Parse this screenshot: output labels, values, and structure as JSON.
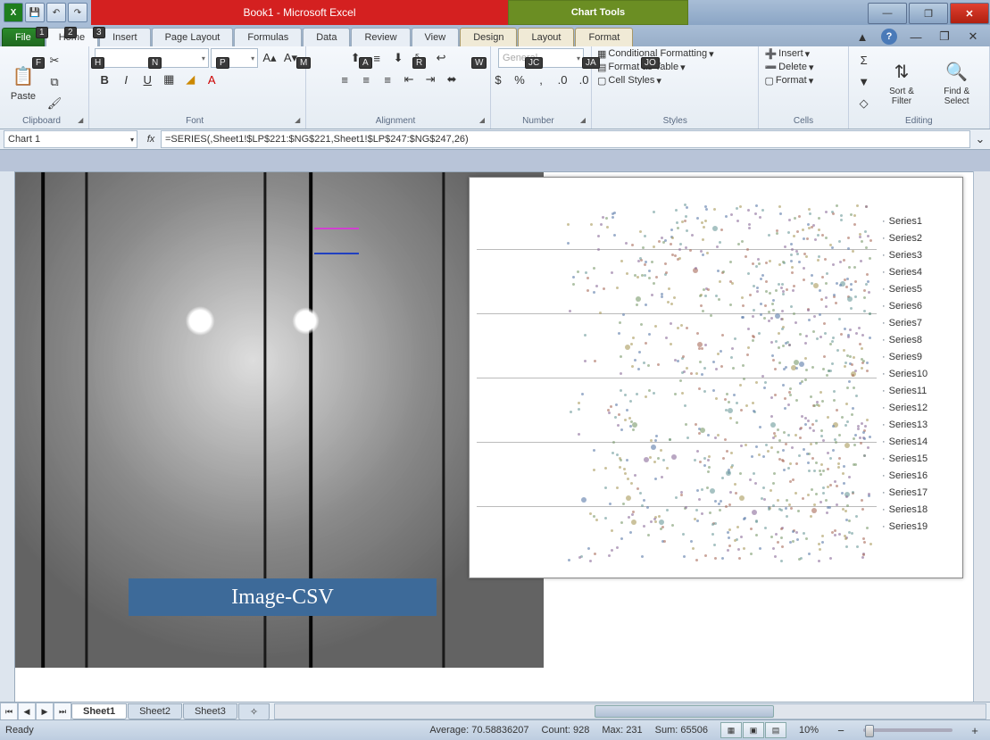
{
  "title": {
    "app": "Book1 - Microsoft Excel",
    "context": "Chart Tools"
  },
  "qat_keytips": [
    "1",
    "2",
    "3"
  ],
  "tabs": {
    "file": "File",
    "home": "Home",
    "insert": "Insert",
    "page_layout": "Page Layout",
    "formulas": "Formulas",
    "data": "Data",
    "review": "Review",
    "view": "View",
    "design": "Design",
    "layout": "Layout",
    "format": "Format"
  },
  "tab_keytips": {
    "file": "F",
    "home": "H",
    "insert": "N",
    "page_layout": "P",
    "formulas": "M",
    "data": "A",
    "review": "R",
    "view": "W",
    "design": "JC",
    "layout": "JA",
    "format": "JO"
  },
  "ribbon": {
    "clipboard": {
      "label": "Clipboard",
      "paste": "Paste"
    },
    "font": {
      "label": "Font",
      "font_name": "",
      "font_size": "",
      "bold": "B",
      "italic": "I",
      "underline": "U"
    },
    "alignment": {
      "label": "Alignment"
    },
    "number": {
      "label": "Number",
      "format": "General"
    },
    "styles": {
      "label": "Styles",
      "cf": "Conditional Formatting",
      "table": "Format as Table",
      "cell": "Cell Styles"
    },
    "cells": {
      "label": "Cells",
      "insert": "Insert",
      "delete": "Delete",
      "format": "Format"
    },
    "editing": {
      "label": "Editing",
      "sort": "Sort & Filter",
      "find": "Find & Select"
    }
  },
  "name_box": "Chart 1",
  "formula": "=SERIES(,Sheet1!$LP$221:$NG$221,Sheet1!$LP$247:$NG$247,26)",
  "image_label": "Image-CSV",
  "chart_data": {
    "type": "scatter",
    "legend": [
      "Series1",
      "Series2",
      "Series3",
      "Series4",
      "Series5",
      "Series6",
      "Series7",
      "Series8",
      "Series9",
      "Series10",
      "Series11",
      "Series12",
      "Series13",
      "Series14",
      "Series15",
      "Series16",
      "Series17",
      "Series18",
      "Series19"
    ],
    "gridlines": 5,
    "note": "dense multi-series scatter; individual point values not legible"
  },
  "sheets": {
    "active": "Sheet1",
    "others": [
      "Sheet2",
      "Sheet3"
    ]
  },
  "status": {
    "ready": "Ready",
    "average_label": "Average:",
    "average": "70.58836207",
    "count_label": "Count:",
    "count": "928",
    "max_label": "Max:",
    "max": "231",
    "sum_label": "Sum:",
    "sum": "65506",
    "zoom": "10%"
  }
}
